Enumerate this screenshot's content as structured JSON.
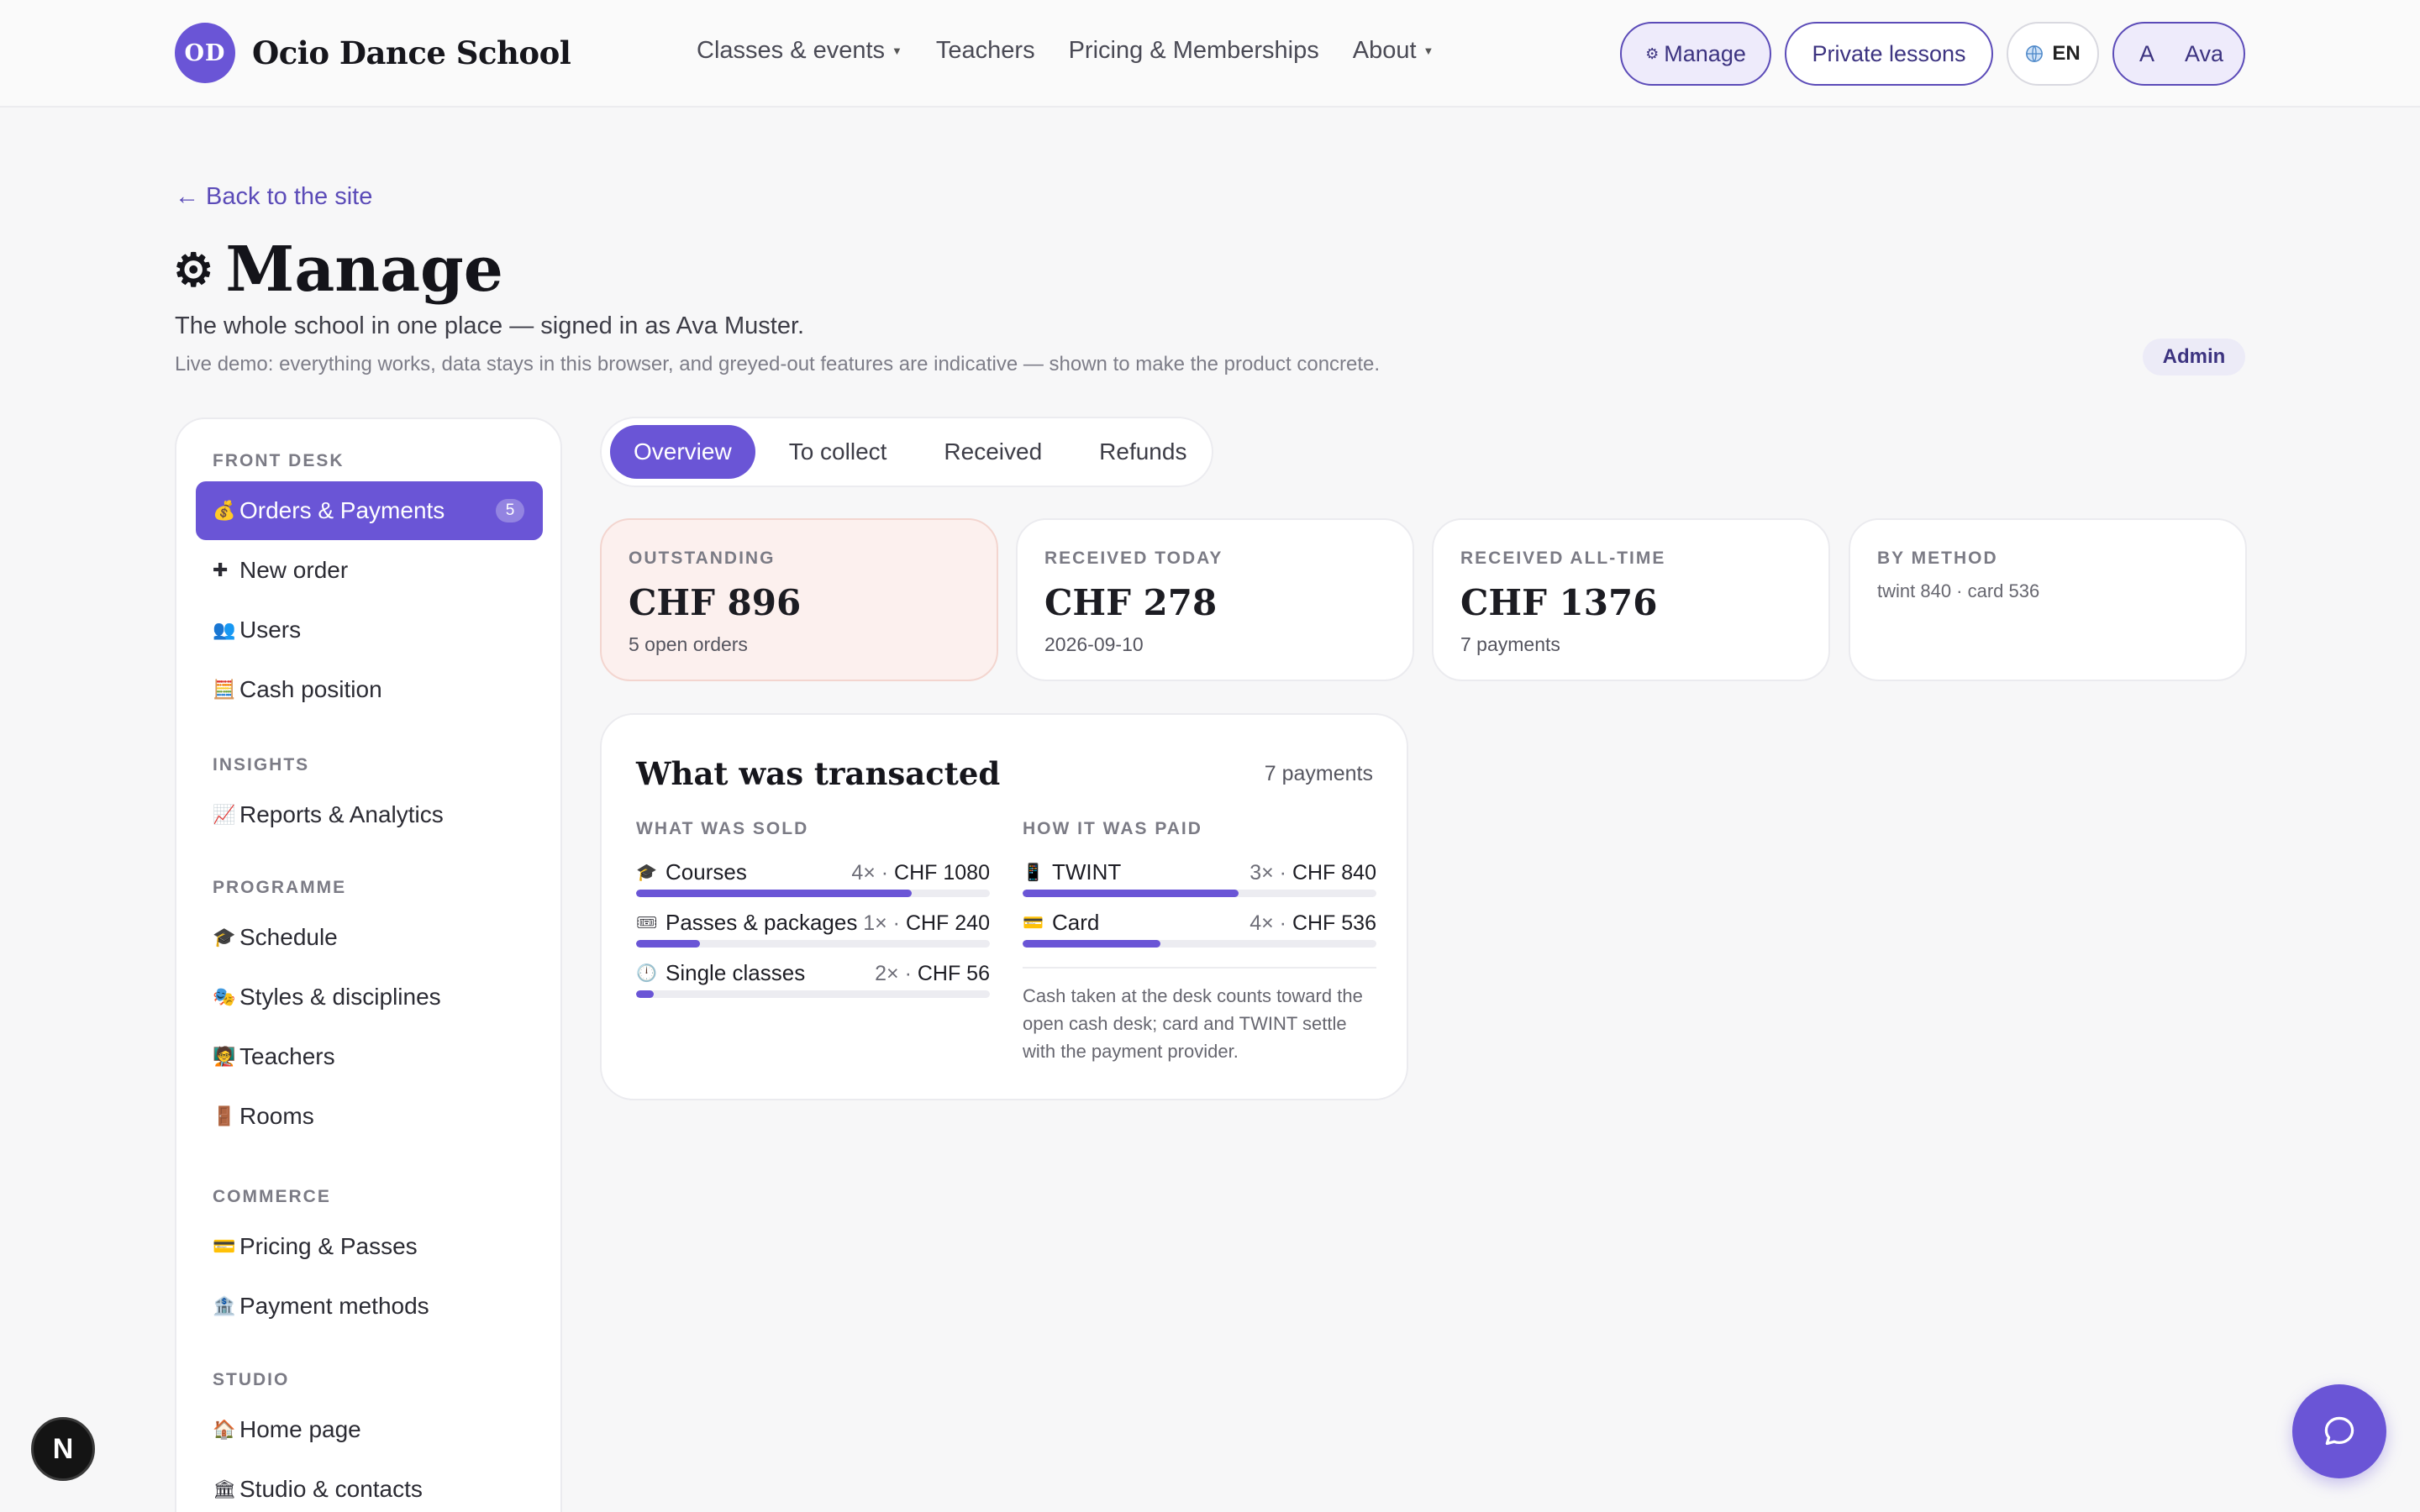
{
  "header": {
    "logo_initials": "OD",
    "brand": "Ocio Dance School",
    "nav": [
      {
        "label": "Classes & events",
        "dropdown": true
      },
      {
        "label": "Teachers",
        "dropdown": false
      },
      {
        "label": "Pricing & Memberships",
        "dropdown": false
      },
      {
        "label": "About",
        "dropdown": true
      }
    ],
    "manage_label": "Manage",
    "private_label": "Private lessons",
    "lang_label": "EN",
    "user_initial": "A",
    "user_name": "Ava"
  },
  "page": {
    "back_label": "← Back to the site",
    "title": "Manage",
    "subtitle": "The whole school in one place — signed in as Ava Muster.",
    "demo_note": "Live demo: everything works, data stays in this browser, and greyed-out features are indicative — shown to make the product concrete.",
    "role_badge": "Admin"
  },
  "sidebar": {
    "sections": [
      {
        "label": "FRONT DESK",
        "items": [
          {
            "icon": "money-bag-icon",
            "glyph": "💰",
            "label": "Orders & Payments",
            "count": "5",
            "active": true
          },
          {
            "icon": "plus-icon",
            "glyph": "✚",
            "label": "New order"
          },
          {
            "icon": "users-icon",
            "glyph": "👥",
            "label": "Users"
          },
          {
            "icon": "abacus-icon",
            "glyph": "🧮",
            "label": "Cash position"
          }
        ]
      },
      {
        "label": "INSIGHTS",
        "items": [
          {
            "icon": "chart-icon",
            "glyph": "📈",
            "label": "Reports & Analytics"
          }
        ]
      },
      {
        "label": "PROGRAMME",
        "items": [
          {
            "icon": "graduation-cap-icon",
            "glyph": "🎓",
            "label": "Schedule"
          },
          {
            "icon": "theater-masks-icon",
            "glyph": "🎭",
            "label": "Styles & disciplines"
          },
          {
            "icon": "teacher-icon",
            "glyph": "🧑‍🏫",
            "label": "Teachers"
          },
          {
            "icon": "door-icon",
            "glyph": "🚪",
            "label": "Rooms"
          }
        ]
      },
      {
        "label": "COMMERCE",
        "items": [
          {
            "icon": "card-icon",
            "glyph": "💳",
            "label": "Pricing & Passes"
          },
          {
            "icon": "bank-icon",
            "glyph": "🏦",
            "label": "Payment methods"
          }
        ]
      },
      {
        "label": "STUDIO",
        "items": [
          {
            "icon": "house-icon",
            "glyph": "🏠",
            "label": "Home page"
          },
          {
            "icon": "building-icon",
            "glyph": "🏛",
            "label": "Studio & contacts"
          }
        ]
      }
    ]
  },
  "tabs": [
    {
      "label": "Overview",
      "active": true
    },
    {
      "label": "To collect"
    },
    {
      "label": "Received"
    },
    {
      "label": "Refunds"
    }
  ],
  "stats": [
    {
      "label": "OUTSTANDING",
      "value": "CHF 896",
      "sub": "5 open orders",
      "tone": "warn"
    },
    {
      "label": "RECEIVED TODAY",
      "value": "CHF 278",
      "sub": "2026-09-10"
    },
    {
      "label": "RECEIVED ALL-TIME",
      "value": "CHF 1376",
      "sub": "7 payments"
    },
    {
      "label": "BY METHOD",
      "method": "twint 840 · card 536"
    }
  ],
  "transacted": {
    "title": "What was transacted",
    "count": "7 payments",
    "sold_label": "WHAT WAS SOLD",
    "paid_label": "HOW IT WAS PAID",
    "sold": [
      {
        "icon": "graduation-cap-icon",
        "glyph": "🎓",
        "name": "Courses",
        "qty": "4×",
        "amount": "CHF 1080",
        "fill": 0.78
      },
      {
        "icon": "ticket-icon",
        "glyph": "🎟",
        "name": "Passes & packages",
        "qty": "1×",
        "amount": "CHF 240",
        "fill": 0.18
      },
      {
        "icon": "clock-icon",
        "glyph": "🕛",
        "name": "Single classes",
        "qty": "2×",
        "amount": "CHF 56",
        "fill": 0.05
      }
    ],
    "paid": [
      {
        "icon": "phone-icon",
        "glyph": "📱",
        "name": "TWINT",
        "qty": "3×",
        "amount": "CHF 840",
        "fill": 0.61
      },
      {
        "icon": "card-icon",
        "glyph": "💳",
        "name": "Card",
        "qty": "4×",
        "amount": "CHF 536",
        "fill": 0.39
      }
    ],
    "note": "Cash taken at the desk counts toward the open cash desk; card and TWINT settle with the payment provider."
  },
  "floating": {
    "next_letter": "N"
  },
  "colors": {
    "accent": "#6a55d6",
    "warn_bg": "#fcf0ee"
  }
}
